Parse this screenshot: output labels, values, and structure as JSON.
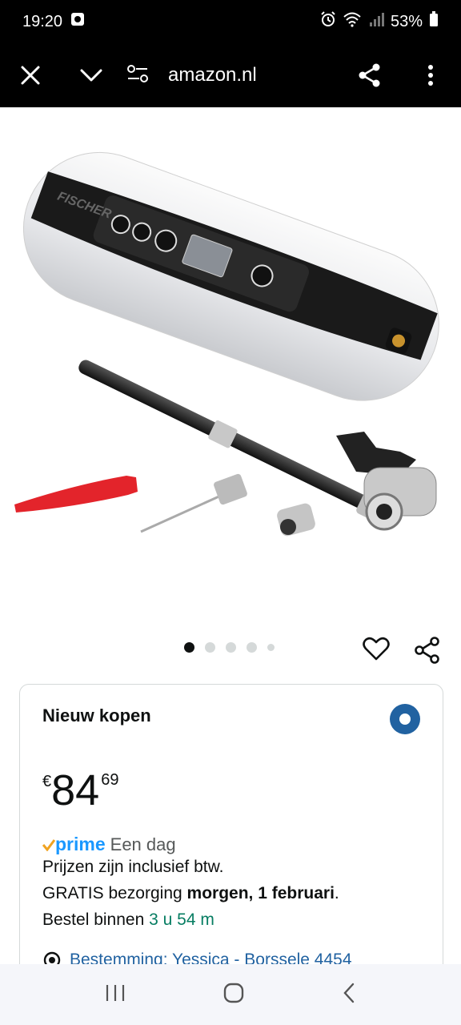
{
  "status": {
    "time": "19:20",
    "battery": "53%"
  },
  "browser": {
    "url": "amazon.nl"
  },
  "gallery": {
    "brand_text": "FISCHER"
  },
  "buy_box": {
    "title": "Nieuw kopen",
    "price": {
      "symbol": "€",
      "whole": "84",
      "fraction": "69"
    },
    "prime_label": "prime",
    "prime_delivery": "Een dag",
    "vat_text": "Prijzen zijn inclusief btw.",
    "delivery_prefix": "GRATIS bezorging ",
    "delivery_date": "morgen, 1 februari",
    "delivery_suffix": ".",
    "order_prefix": "Bestel binnen ",
    "order_time": "3 u 54 m",
    "destination": "Bestemming: Yessica - Borssele 4454"
  },
  "colors": {
    "link_blue": "#2162a1",
    "prime_blue": "#1a98ff",
    "green": "#067d62"
  }
}
